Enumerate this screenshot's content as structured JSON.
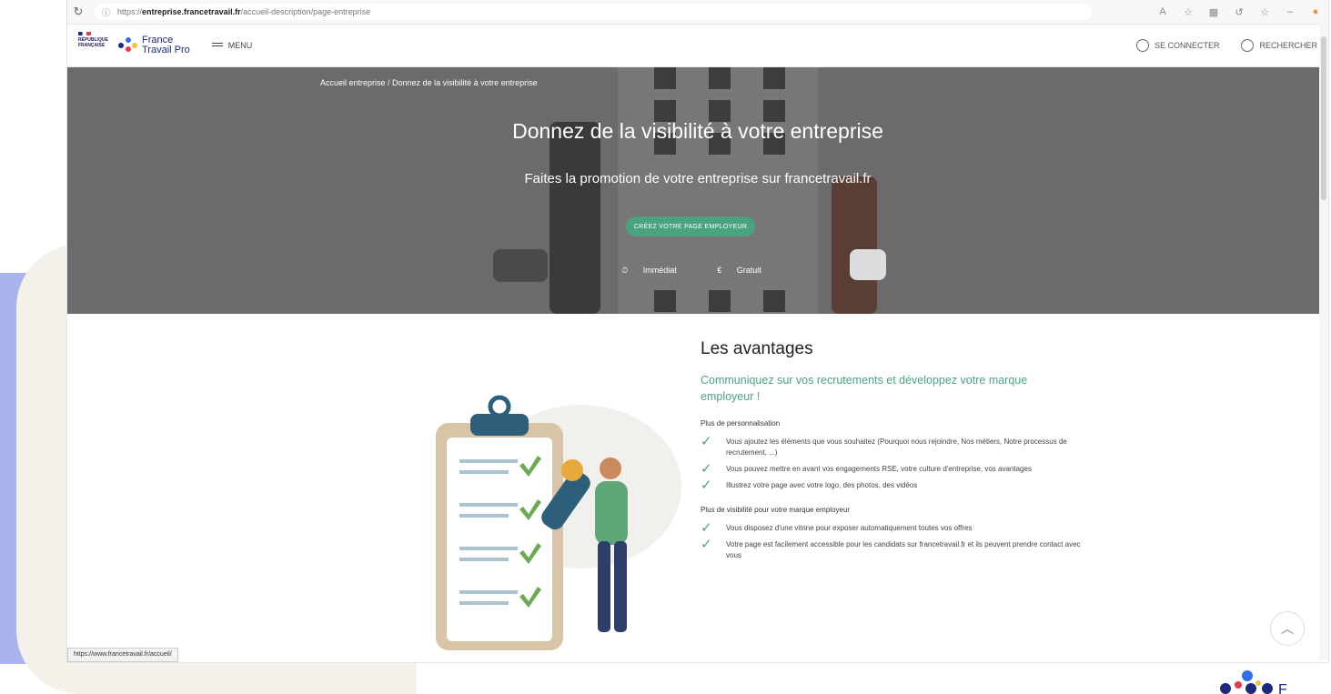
{
  "browser": {
    "url_prefix": "https://",
    "url_host": "entreprise.francetravail.fr",
    "url_path": "/accueil-description/page-entreprise",
    "status_url": "https://www.francetravail.fr/accueil/"
  },
  "header": {
    "rf_logo": "RÉPUBLIQUE FRANÇAISE",
    "brand_line1": "France",
    "brand_line2": "Travail Pro",
    "menu_label": "MENU",
    "login_label": "SE CONNECTER",
    "search_label": "RECHERCHER"
  },
  "hero": {
    "breadcrumb": "Accueil entreprise / Donnez de la visibilité à votre entreprise",
    "title": "Donnez de la visibilité à votre entreprise",
    "subtitle": "Faites la promotion de votre entreprise sur francetravail.fr",
    "cta": "CRÉEZ VOTRE PAGE EMPLOYEUR",
    "badge_immediate": "Immédiat",
    "badge_free": "Gratuit"
  },
  "avantages": {
    "title": "Les avantages",
    "lead": "Communiquez sur vos recrutements et développez votre marque employeur !",
    "section1": "Plus de personnalisation",
    "items1": [
      "Vous ajoutez les éléments que vous souhaitez (Pourquoi nous rejoindre, Nos métiers, Notre processus de recrutement, ...)",
      "Vous pouvez mettre en avant vos engagements RSE, votre culture d'entreprise, vos avantages",
      "Illustrez votre page avec votre logo, des photos, des vidéos"
    ],
    "section2": "Plus de visibilité pour votre marque employeur",
    "items2": [
      "Vous disposez d'une vitrine pour exposer automatiquement toutes vos offres",
      "Votre page est facilement accessible pour les candidats sur francetravail.fr et ils peuvent prendre contact avec vous"
    ]
  },
  "colors": {
    "accent_green": "#4aa37f",
    "hero_gray": "#6b6b6b",
    "deco_blue": "#a9b4ec",
    "deco_beige": "#f4f1ea"
  }
}
